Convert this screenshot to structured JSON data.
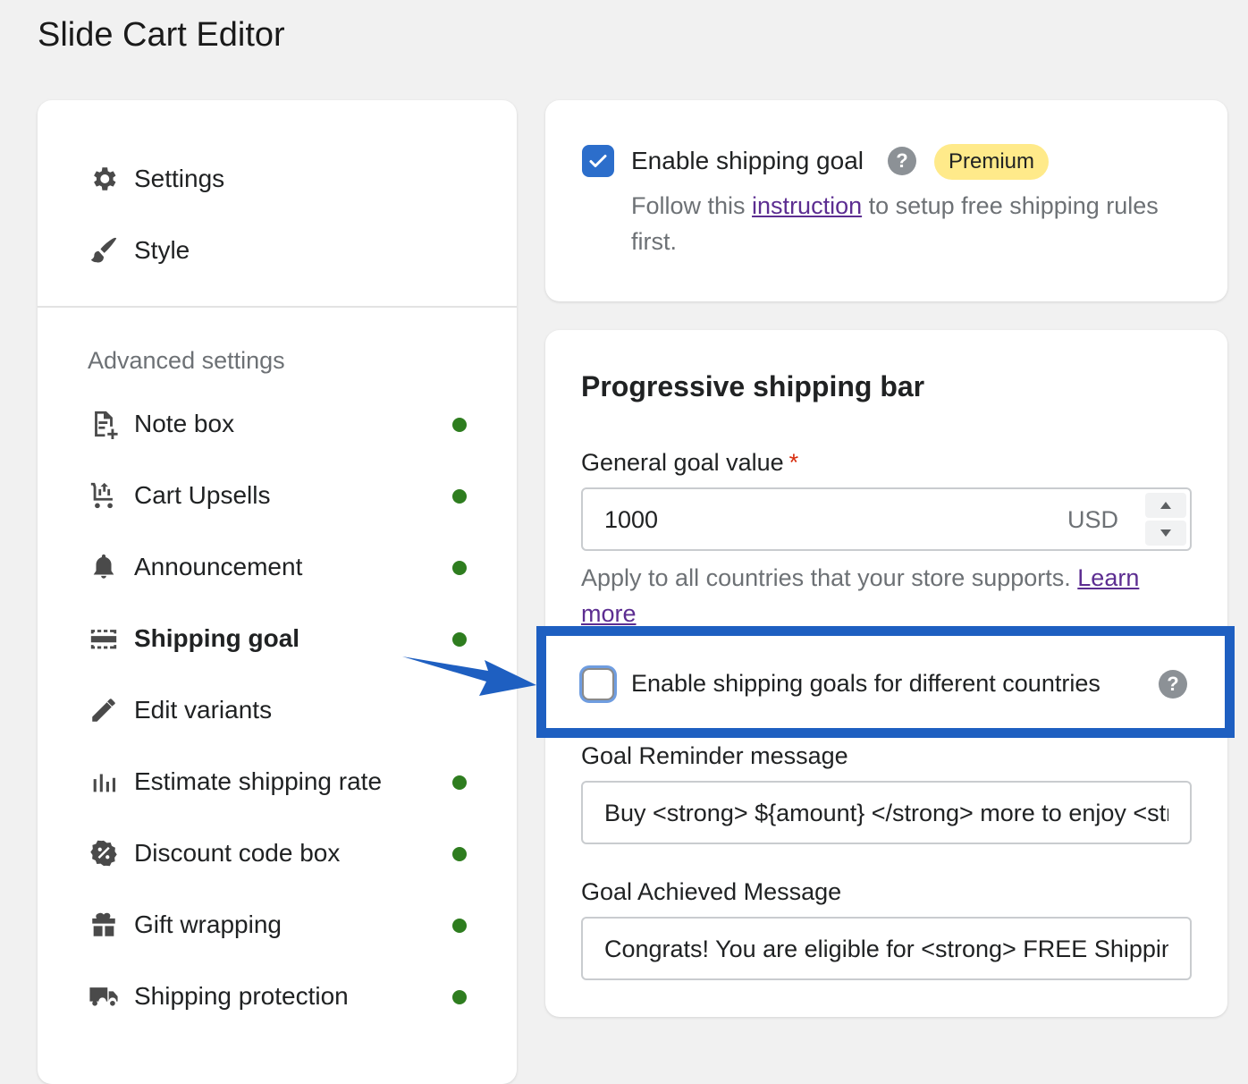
{
  "page": {
    "title": "Slide Cart Editor"
  },
  "sidebar": {
    "top_items": [
      {
        "label": "Settings",
        "icon": "gear-icon"
      },
      {
        "label": "Style",
        "icon": "brush-icon"
      }
    ],
    "section_label": "Advanced settings",
    "items": [
      {
        "label": "Note box",
        "icon": "note-icon",
        "enabled": true
      },
      {
        "label": "Cart Upsells",
        "icon": "cart-upsell-icon",
        "enabled": true
      },
      {
        "label": "Announcement",
        "icon": "bell-icon",
        "enabled": true
      },
      {
        "label": "Shipping goal",
        "icon": "progress-bar-icon",
        "enabled": true,
        "active": true
      },
      {
        "label": "Edit variants",
        "icon": "pencil-icon",
        "enabled": false
      },
      {
        "label": "Estimate shipping rate",
        "icon": "bar-chart-icon",
        "enabled": true
      },
      {
        "label": "Discount code box",
        "icon": "discount-icon",
        "enabled": true
      },
      {
        "label": "Gift wrapping",
        "icon": "gift-icon",
        "enabled": true
      },
      {
        "label": "Shipping protection",
        "icon": "truck-icon",
        "enabled": true
      }
    ],
    "status_color": "#2e7d1f"
  },
  "shipping_goal_card": {
    "enable_label": "Enable shipping goal",
    "enabled": true,
    "badge": "Premium",
    "help_text_before": "Follow this ",
    "help_link": "instruction",
    "help_text_after": " to setup free shipping rules first."
  },
  "progressive_card": {
    "title": "Progressive shipping bar",
    "goal_label": "General goal value",
    "required_mark": "*",
    "goal_value": "1000",
    "goal_currency": "USD",
    "apply_text": "Apply to all countries that your store supports. ",
    "learn_more": "Learn more",
    "countries_label": "Enable shipping goals for different countries",
    "countries_enabled": false,
    "reminder_label": "Goal Reminder message",
    "reminder_value": "Buy <strong> ${amount} </strong> more to enjoy <strong>FREE Shipping</strong>",
    "achieved_label": "Goal Achieved Message",
    "achieved_value": "Congrats! You are eligible for <strong> FREE Shipping</strong>"
  },
  "colors": {
    "accent": "#2c6ecb",
    "highlight": "#1e5fc1",
    "badge": "#ffea8a"
  }
}
